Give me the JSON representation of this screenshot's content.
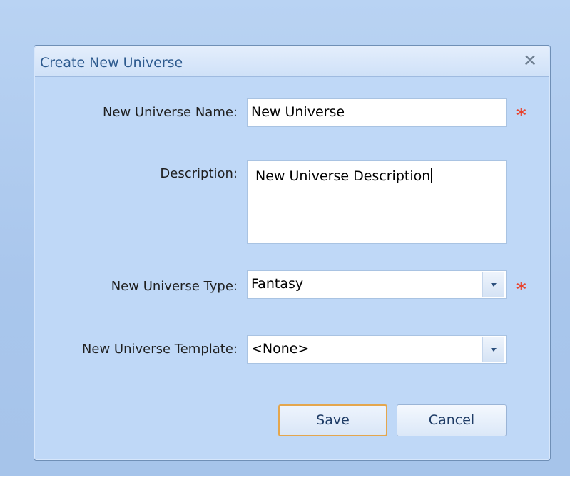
{
  "dialog": {
    "title": "Create New Universe",
    "close_glyph": "✕",
    "required_marker": "*"
  },
  "form": {
    "name_label": "New Universe Name:",
    "name_value": "New Universe",
    "description_label": "Description:",
    "description_value": "New Universe Description",
    "type_label": "New Universe Type:",
    "type_value": "Fantasy",
    "template_label": "New Universe Template:",
    "template_value": "<None>"
  },
  "buttons": {
    "save_label": "Save",
    "cancel_label": "Cancel"
  },
  "icons": {
    "close": "close-icon",
    "dropdown": "chevron-down-icon"
  },
  "colors": {
    "required": "#e8412c",
    "title_text": "#2d5a8e",
    "default_button_border": "#e4a64d"
  }
}
